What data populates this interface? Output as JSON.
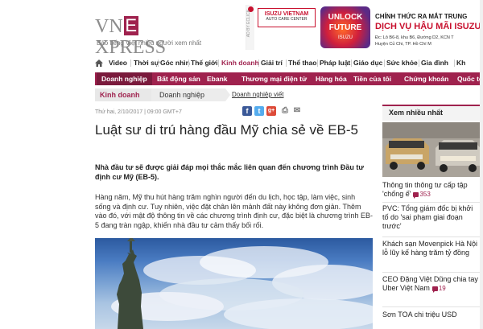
{
  "header": {
    "logo_prefix": "VN",
    "logo_e": "E",
    "logo_suffix": "XPRESS",
    "tagline": "Báo tiếng Việt nhiều người xem nhất"
  },
  "banner": {
    "badge": "AD BY ECLICK",
    "isuzu_line1": "ISUZU VIETNAM",
    "isuzu_line2": "AUTO CARE CENTER",
    "unlock_line1": "UNLOCK",
    "unlock_line2": "FUTURE",
    "unlock_line3": "ISUZU",
    "title1": "CHÍNH THỨC RA MẮT TRUNG",
    "title2": "DỊCH VỤ HẬU MÃI ISUZU",
    "addr1": "Đc: Lô B6-8, khu B6, Đường D2, KCN T",
    "addr2": "Huyện Củ Chi, TP. Hồ Chí M"
  },
  "main_nav": [
    {
      "label": "Video"
    },
    {
      "label": "Thời sự"
    },
    {
      "label": "Góc nhìn"
    },
    {
      "label": "Thế giới"
    },
    {
      "label": "Kinh doanh"
    },
    {
      "label": "Giải trí"
    },
    {
      "label": "Thể thao"
    },
    {
      "label": "Pháp luật"
    },
    {
      "label": "Giáo dục"
    },
    {
      "label": "Sức khỏe"
    },
    {
      "label": "Gia đình"
    },
    {
      "label": "Kh"
    }
  ],
  "sub_nav": [
    {
      "label": "Doanh nghiệp"
    },
    {
      "label": "Bất động sản"
    },
    {
      "label": "Ebank"
    },
    {
      "label": "Thương mại điện tử"
    },
    {
      "label": "Hàng hóa"
    },
    {
      "label": "Tiền của tôi"
    },
    {
      "label": "Chứng khoán"
    },
    {
      "label": "Quốc tế"
    }
  ],
  "breadcrumb": {
    "c1": "Kinh doanh",
    "c2": "Doanh nghiệp",
    "c3": "Doanh nghiệp viết"
  },
  "article": {
    "meta": "Thứ hai, 2/10/2017 | 09:00 GMT+7",
    "title": "Luật sư di trú hàng đầu Mỹ chia sẻ về EB-5",
    "lead": "Nhà đầu tư sẽ được giải đáp mọi thắc mắc liên quan đến chương trình Đầu tư định cư Mỹ (EB-5).",
    "body": "Hàng năm, Mỹ thu hút hàng trăm nghìn người đến du lịch, học tập, làm việc, sinh sống và định cư. Tuy nhiên, việc đặt chân lên mảnh đất này không đơn giản. Thêm vào đó, với mật độ thông tin về các chương trình định cư, đặc biệt là chương trình EB-5 đang tràn ngập, khiến nhà đầu tư cảm thấy bối rối."
  },
  "social": {
    "facebook": "f",
    "twitter": "t",
    "google": "g+",
    "print": "⎙",
    "share": "✉"
  },
  "sidebar": {
    "heading": "Xem nhiều nhất",
    "items": [
      {
        "text": "Thông tin thông tư cấp tập 'chống ế'",
        "comments": "353"
      },
      {
        "text": "PVC: Tổng giám đốc bị khởi tố do 'sai phạm giai đoạn trước'",
        "comments": ""
      },
      {
        "text": "Khách sạn Movenpick Hà Nội lỗ lũy kế hàng trăm tỷ đồng",
        "comments": ""
      },
      {
        "text": "CEO Đặng Việt Dũng chia tay Uber Việt Nam",
        "comments": "19"
      },
      {
        "text": "Sơn TOA chi triệu USD",
        "comments": ""
      }
    ]
  }
}
